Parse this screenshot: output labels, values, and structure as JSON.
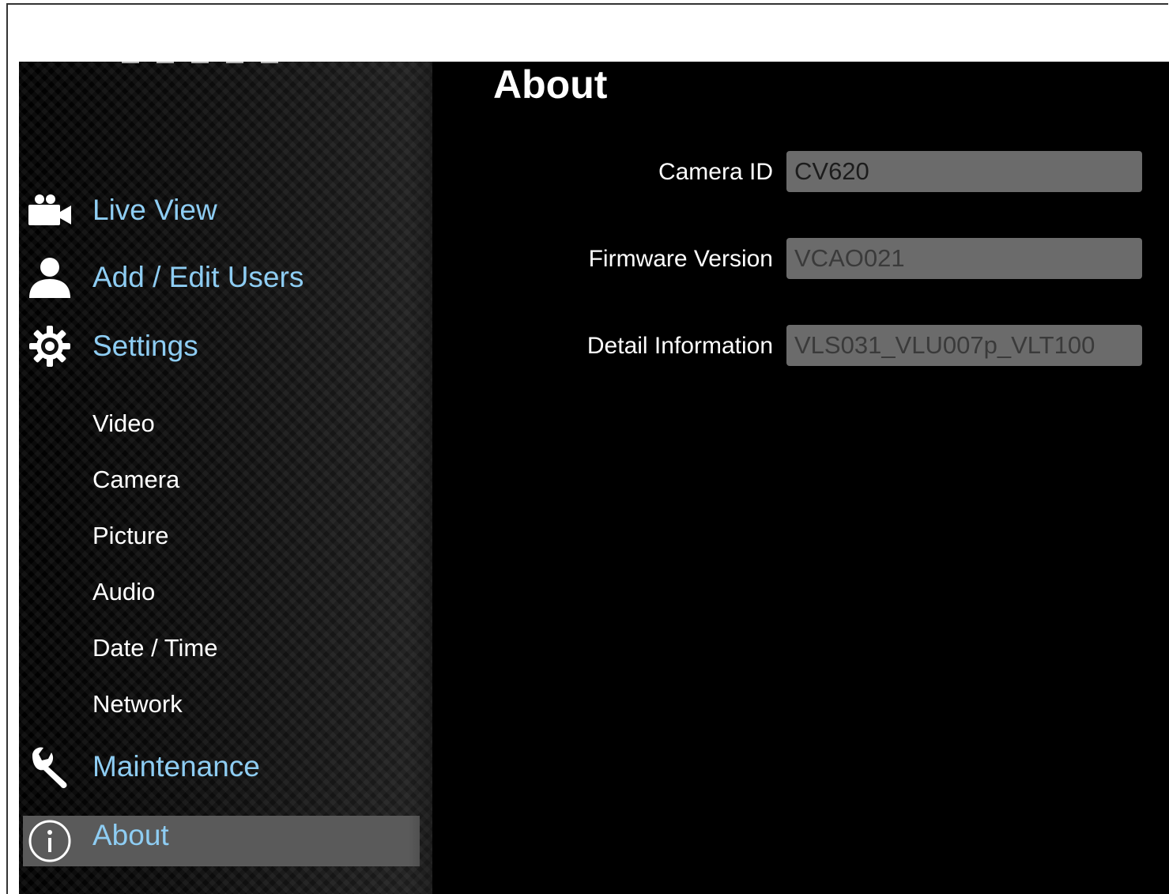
{
  "sidebar": {
    "main_items": [
      {
        "label": "Live View",
        "icon": "video-camera-icon"
      },
      {
        "label": "Add / Edit Users",
        "icon": "user-icon"
      },
      {
        "label": "Settings",
        "icon": "gear-icon"
      }
    ],
    "settings_subitems": [
      "Video",
      "Camera",
      "Picture",
      "Audio",
      "Date / Time",
      "Network"
    ],
    "maintenance": {
      "label": "Maintenance",
      "icon": "wrench-icon"
    },
    "about": {
      "label": "About",
      "icon": "info-icon",
      "active": true
    }
  },
  "main": {
    "title": "About",
    "fields": [
      {
        "label": "Camera ID",
        "value": "CV620"
      },
      {
        "label": "Firmware Version",
        "value": "VCAO021"
      },
      {
        "label": "Detail Information",
        "value": "VLS031_VLU007p_VLT100"
      }
    ]
  },
  "colors": {
    "nav_link": "#8ecdf3",
    "active_bg": "#5a5a5a",
    "input_bg": "#6b6b6b",
    "background": "#000000"
  }
}
